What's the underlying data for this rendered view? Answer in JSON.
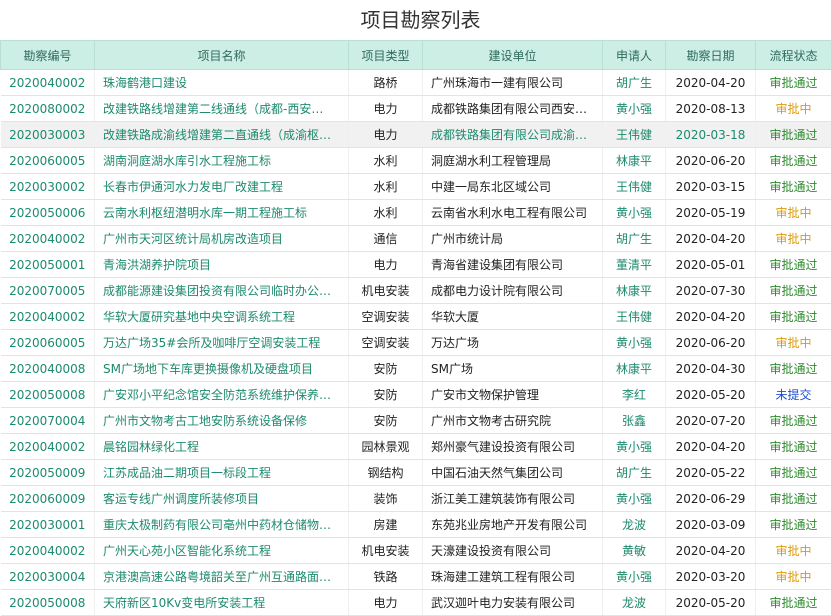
{
  "page": {
    "title": "项目勘察列表"
  },
  "table": {
    "headers": [
      "勘察编号",
      "项目名称",
      "项目类型",
      "建设单位",
      "申请人",
      "勘察日期",
      "流程状态"
    ],
    "rows": [
      {
        "code": "2020040002",
        "name": "珠海鹤港口建设",
        "type": "路桥",
        "unit": "广州珠海市一建有限公司",
        "applicant": "胡广生",
        "date": "2020-04-20",
        "status": "审批通过",
        "status_kind": "ok"
      },
      {
        "code": "2020080002",
        "name": "改建铁路线增建第二线通线（成都-西安…",
        "type": "电力",
        "unit": "成都铁路集团有限公司西安…",
        "applicant": "黄小强",
        "date": "2020-08-13",
        "status": "审批中",
        "status_kind": "ing"
      },
      {
        "code": "2020030003",
        "name": "改建铁路成渝线增建第二直通线（成渝枢…",
        "type": "电力",
        "unit": "成都铁路集团有限公司成渝…",
        "applicant": "王伟健",
        "date": "2020-03-18",
        "status": "审批通过",
        "status_kind": "ok"
      },
      {
        "code": "2020060005",
        "name": "湖南洞庭湖水库引水工程施工标",
        "type": "水利",
        "unit": "洞庭湖水利工程管理局",
        "applicant": "林康平",
        "date": "2020-06-20",
        "status": "审批通过",
        "status_kind": "ok"
      },
      {
        "code": "2020030002",
        "name": "长春市伊通河水力发电厂改建工程",
        "type": "水利",
        "unit": "中建一局东北区域公司",
        "applicant": "王伟健",
        "date": "2020-03-15",
        "status": "审批通过",
        "status_kind": "ok"
      },
      {
        "code": "2020050006",
        "name": "云南水利枢纽潜明水库一期工程施工标",
        "type": "水利",
        "unit": "云南省水利水电工程有限公司",
        "applicant": "黄小强",
        "date": "2020-05-19",
        "status": "审批中",
        "status_kind": "ing"
      },
      {
        "code": "2020040002",
        "name": "广州市天河区统计局机房改造项目",
        "type": "通信",
        "unit": "广州市统计局",
        "applicant": "胡广生",
        "date": "2020-04-20",
        "status": "审批中",
        "status_kind": "ing"
      },
      {
        "code": "2020050001",
        "name": "青海洪湖养护院项目",
        "type": "电力",
        "unit": "青海省建设集团有限公司",
        "applicant": "董清平",
        "date": "2020-05-01",
        "status": "审批通过",
        "status_kind": "ok"
      },
      {
        "code": "2020070005",
        "name": "成都能源建设集团投资有限公司临时办公…",
        "type": "机电安装",
        "unit": "成都电力设计院有限公司",
        "applicant": "林康平",
        "date": "2020-07-30",
        "status": "审批通过",
        "status_kind": "ok"
      },
      {
        "code": "2020040002",
        "name": "华软大厦研究基地中央空调系统工程",
        "type": "空调安装",
        "unit": "华软大厦",
        "applicant": "王伟健",
        "date": "2020-04-20",
        "status": "审批通过",
        "status_kind": "ok"
      },
      {
        "code": "2020060005",
        "name": "万达广场35#会所及咖啡厅空调安装工程",
        "type": "空调安装",
        "unit": "万达广场",
        "applicant": "黄小强",
        "date": "2020-06-20",
        "status": "审批中",
        "status_kind": "ing"
      },
      {
        "code": "2020040008",
        "name": "SM广场地下车库更换摄像机及硬盘项目",
        "type": "安防",
        "unit": "SM广场",
        "applicant": "林康平",
        "date": "2020-04-30",
        "status": "审批通过",
        "status_kind": "ok"
      },
      {
        "code": "2020050008",
        "name": "广安邓小平纪念馆安全防范系统维护保养…",
        "type": "安防",
        "unit": "广安市文物保护管理",
        "applicant": "李红",
        "date": "2020-05-20",
        "status": "未提交",
        "status_kind": "no"
      },
      {
        "code": "2020070004",
        "name": "广州市文物考古工地安防系统设备保修",
        "type": "安防",
        "unit": "广州市文物考古研究院",
        "applicant": "张鑫",
        "date": "2020-07-20",
        "status": "审批通过",
        "status_kind": "ok"
      },
      {
        "code": "2020040002",
        "name": "晨铭园林绿化工程",
        "type": "园林景观",
        "unit": "郑州豪气建设投资有限公司",
        "applicant": "黄小强",
        "date": "2020-04-20",
        "status": "审批通过",
        "status_kind": "ok"
      },
      {
        "code": "2020050009",
        "name": "江苏成品油二期项目一标段工程",
        "type": "钢结构",
        "unit": "中国石油天然气集团公司",
        "applicant": "胡广生",
        "date": "2020-05-22",
        "status": "审批通过",
        "status_kind": "ok"
      },
      {
        "code": "2020060009",
        "name": "客运专线广州调度所装修项目",
        "type": "装饰",
        "unit": "浙江美工建筑装饰有限公司",
        "applicant": "黄小强",
        "date": "2020-06-29",
        "status": "审批通过",
        "status_kind": "ok"
      },
      {
        "code": "2020030001",
        "name": "重庆太极制药有限公司亳州中药材仓储物…",
        "type": "房建",
        "unit": "东苑兆业房地产开发有限公司",
        "applicant": "龙波",
        "date": "2020-03-09",
        "status": "审批通过",
        "status_kind": "ok"
      },
      {
        "code": "2020040002",
        "name": "广州天心苑小区智能化系统工程",
        "type": "机电安装",
        "unit": "天濠建设投资有限公司",
        "applicant": "黄敏",
        "date": "2020-04-20",
        "status": "审批中",
        "status_kind": "ing"
      },
      {
        "code": "2020030004",
        "name": "京港澳高速公路粤境韶关至广州互通路面…",
        "type": "铁路",
        "unit": "珠海建工建筑工程有限公司",
        "applicant": "黄小强",
        "date": "2020-03-20",
        "status": "审批中",
        "status_kind": "ing"
      },
      {
        "code": "2020050008",
        "name": "天府新区10Kv变电所安装工程",
        "type": "电力",
        "unit": "武汉迦叶电力安装有限公司",
        "applicant": "龙波",
        "date": "2020-05-20",
        "status": "审批通过",
        "status_kind": "ok"
      }
    ]
  }
}
